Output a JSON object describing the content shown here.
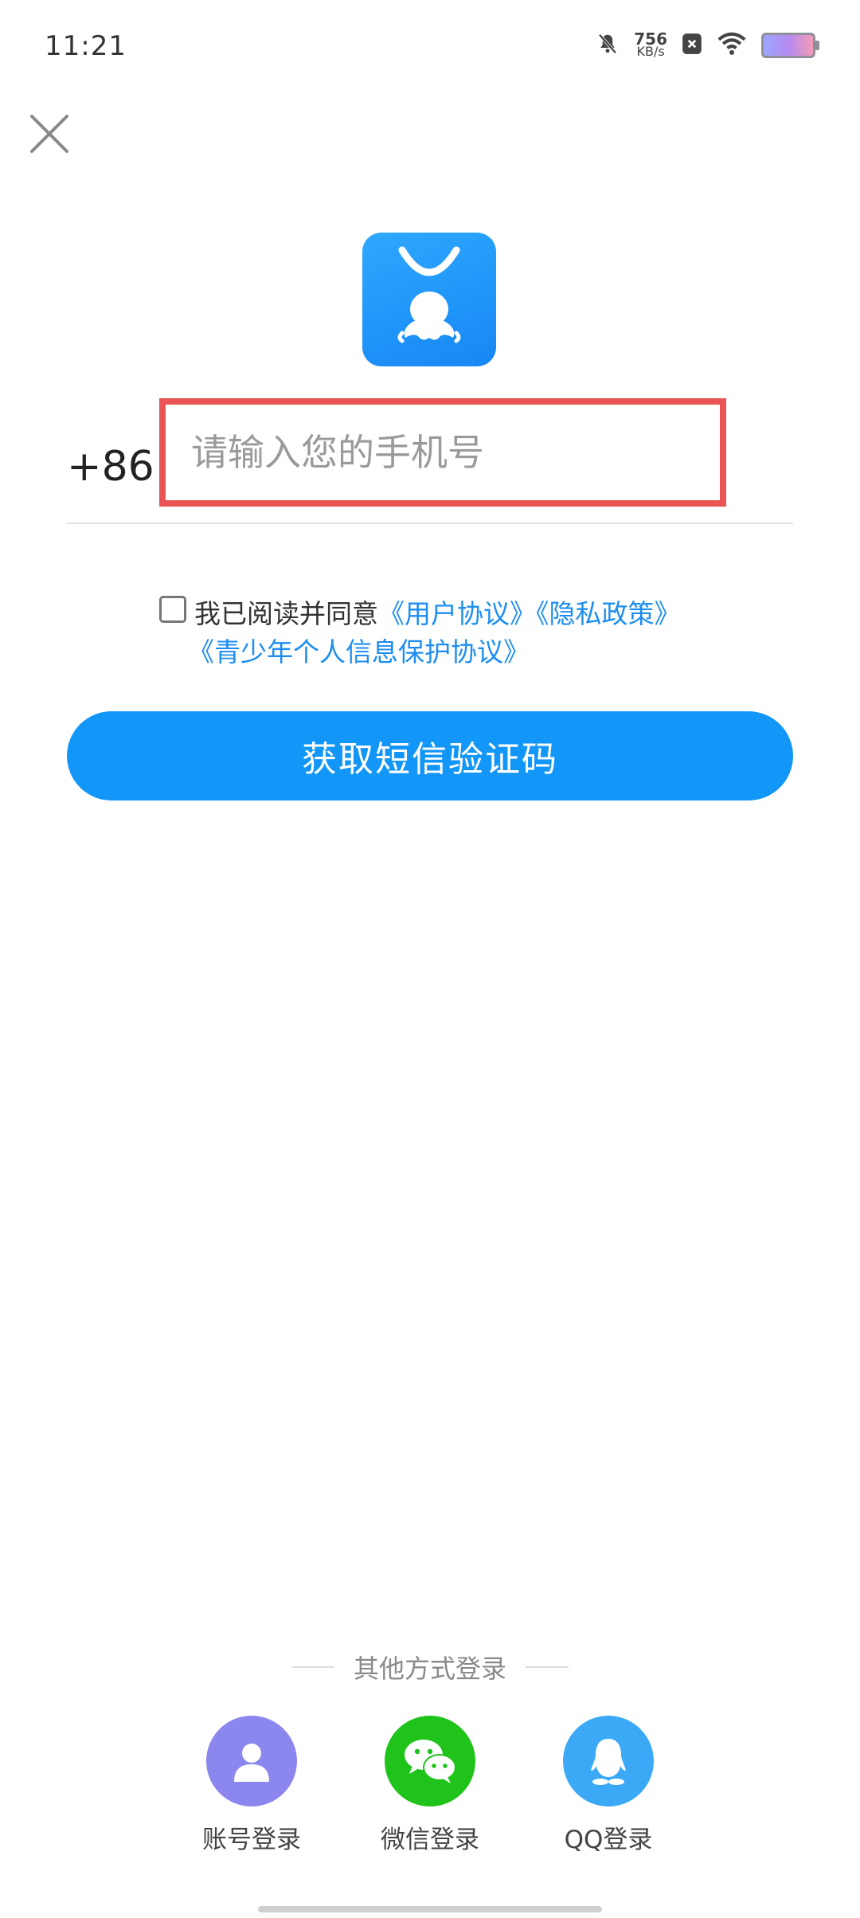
{
  "status_bar": {
    "time": "11:21",
    "net_speed_value": "756",
    "net_speed_unit": "KB/s",
    "icons": [
      "mute-bell-icon",
      "notification-x-icon",
      "wifi-icon",
      "battery-icon"
    ]
  },
  "header": {
    "close_icon": "close-icon"
  },
  "logo": {
    "icon": "app-logo-icon",
    "brand_color": "#1a8ff6"
  },
  "phone": {
    "country_code": "+86",
    "placeholder": "请输入您的手机号",
    "value": ""
  },
  "agreement": {
    "checked": false,
    "prefix": "我已阅读并同意",
    "user_agreement": "《用户协议》",
    "privacy_policy": "《隐私政策》",
    "minor_protection": "《青少年个人信息保护协议》"
  },
  "primary_button": {
    "label": "获取短信验证码",
    "color": "#1296f7"
  },
  "other_login": {
    "title": "其他方式登录",
    "options": [
      {
        "label": "账号登录",
        "icon": "user-icon",
        "color": "#8b87ef"
      },
      {
        "label": "微信登录",
        "icon": "wechat-icon",
        "color": "#1fc31a"
      },
      {
        "label": "QQ登录",
        "icon": "qq-penguin-icon",
        "color": "#3ba9f5"
      }
    ]
  },
  "highlight_color": "#ea5454"
}
